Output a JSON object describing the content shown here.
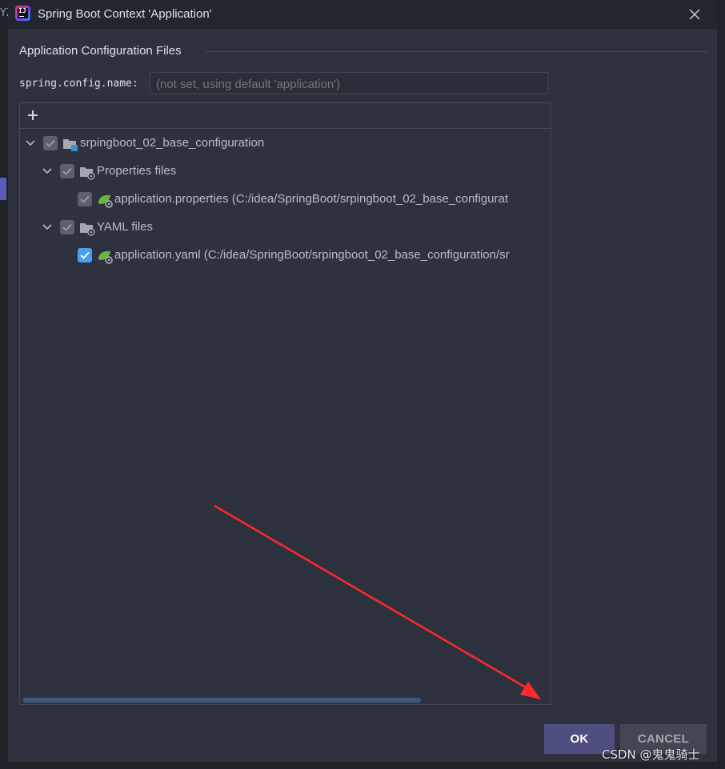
{
  "window": {
    "title": "Spring Boot Context 'Application'"
  },
  "background": {
    "frag_top_left": "YZ"
  },
  "section": {
    "title": "Application Configuration Files"
  },
  "config_name": {
    "label": "spring.config.name:",
    "placeholder": "(not set, using default 'application')"
  },
  "tree": {
    "items": [
      {
        "label": "srpingboot_02_base_configuration",
        "checked": "partial",
        "icon": "module-folder-icon"
      },
      {
        "label": "Properties files",
        "checked": "partial",
        "icon": "config-folder-icon"
      },
      {
        "label": "application.properties (C:/idea/SpringBoot/srpingboot_02_base_configurat",
        "checked": "partial",
        "icon": "spring-config-file-icon"
      },
      {
        "label": "YAML files",
        "checked": "partial",
        "icon": "config-folder-icon"
      },
      {
        "label": "application.yaml (C:/idea/SpringBoot/srpingboot_02_base_configuration/sr",
        "checked": "true",
        "icon": "spring-config-file-icon"
      }
    ]
  },
  "buttons": {
    "ok": "OK",
    "cancel": "CANCEL"
  },
  "watermark": "CSDN @鬼鬼骑士",
  "colors": {
    "dialog_bg": "#2e323f",
    "accent_blue": "#4a9ef3",
    "ok_button": "#4e4f80",
    "annotation_arrow": "#ff2a2a"
  }
}
